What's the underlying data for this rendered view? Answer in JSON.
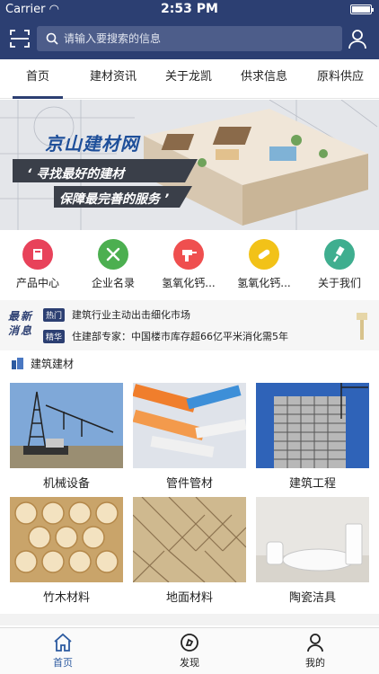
{
  "status_bar": {
    "carrier": "Carrier",
    "time": "2:53 PM"
  },
  "search": {
    "placeholder": "请输入要搜索的信息"
  },
  "nav_tabs": [
    "首页",
    "建材资讯",
    "关于龙凯",
    "供求信息",
    "原料供应"
  ],
  "banner": {
    "title": "京山建材网",
    "slogan1": "寻找最好的建材",
    "slogan2": "保障最完善的服务"
  },
  "categories": [
    {
      "label": "产品中心",
      "icon": "product-icon",
      "color": "#e8425a"
    },
    {
      "label": "企业名录",
      "icon": "tools-icon",
      "color": "#4caf50"
    },
    {
      "label": "氢氧化钙...",
      "icon": "drill-icon",
      "color": "#ef4f4f"
    },
    {
      "label": "氢氧化钙...",
      "icon": "roller-icon",
      "color": "#f2c218"
    },
    {
      "label": "关于我们",
      "icon": "brush-icon",
      "color": "#3fae8f"
    }
  ],
  "news": {
    "logo_line1": "最新",
    "logo_line2": "消息",
    "items": [
      {
        "tag": "热门",
        "text": "建筑行业主动出击细化市场"
      },
      {
        "tag": "精华",
        "text": "住建部专家：中国楼市库存超66亿平米消化需5年"
      }
    ]
  },
  "section": {
    "title": "建筑建材"
  },
  "products": [
    {
      "label": "机械设备"
    },
    {
      "label": "管件管材"
    },
    {
      "label": "建筑工程"
    },
    {
      "label": "竹木材料"
    },
    {
      "label": "地面材料"
    },
    {
      "label": "陶瓷洁具"
    }
  ],
  "tabbar": [
    {
      "label": "首页",
      "icon": "home-icon"
    },
    {
      "label": "发现",
      "icon": "compass-icon"
    },
    {
      "label": "我的",
      "icon": "person-icon"
    }
  ],
  "colors": {
    "primary": "#2c3f72",
    "active_tab": "#2c5aa0"
  }
}
